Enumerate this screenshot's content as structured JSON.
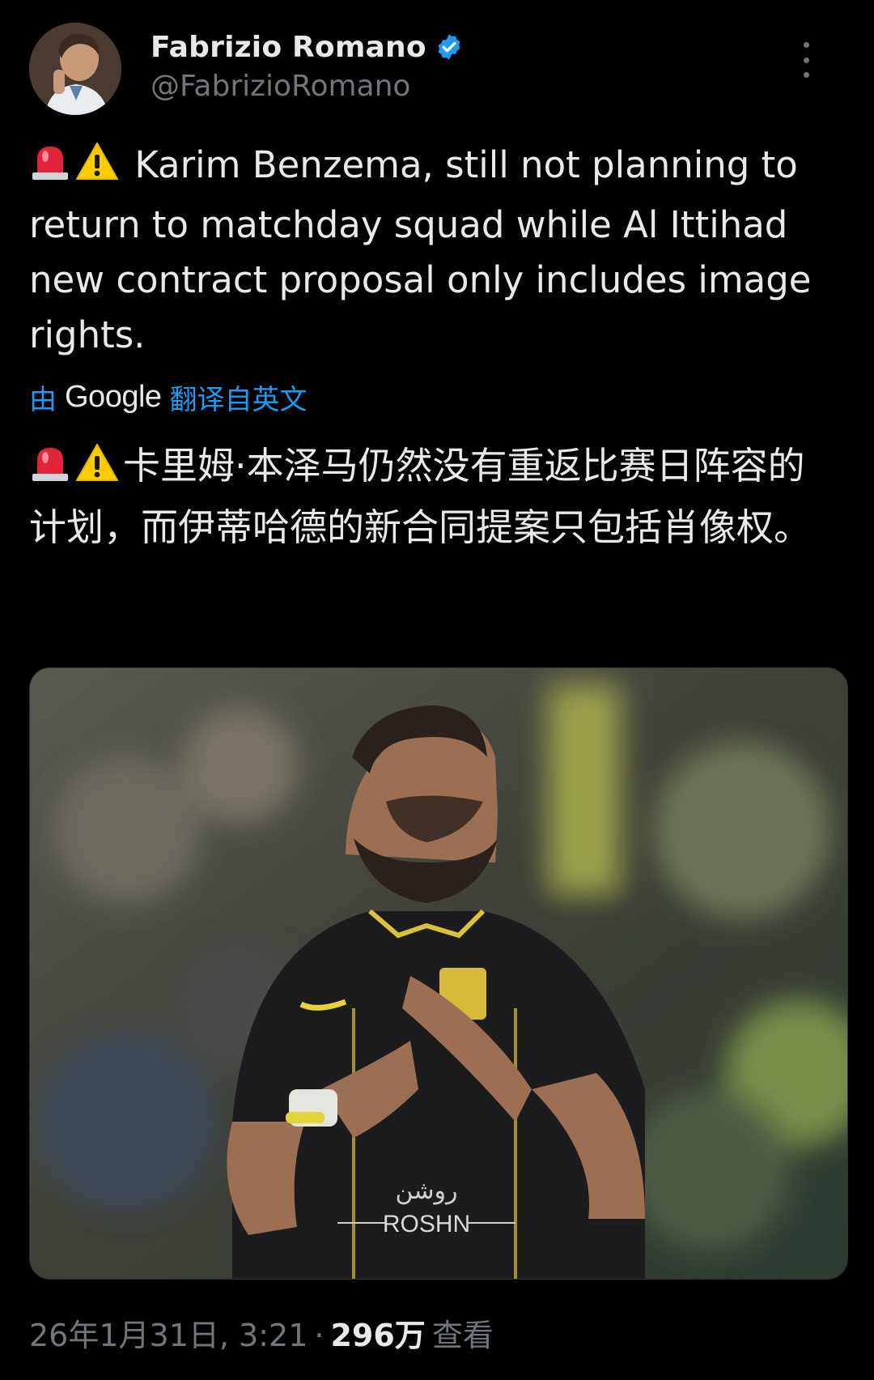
{
  "author": {
    "display_name": "Fabrizio Romano",
    "handle": "@FabrizioRomano",
    "verified": true,
    "verified_color": "#1d9bf0"
  },
  "tweet": {
    "emojis": [
      "rotating-light",
      "warning"
    ],
    "text": "Karim Benzema, still not planning to return to matchday squad while Al Ittihad new contract proposal only includes image rights.",
    "translation": {
      "prefix": "由",
      "provider": "Google",
      "link_label": "翻译自英文",
      "text": "卡里姆·本泽马仍然没有重返比赛日阵容的计划，而伊蒂哈德的新合同提案只包括肖像权。"
    },
    "media": {
      "jersey_text_latin": "ROSHN",
      "jersey_text_arabic": "روشن"
    }
  },
  "meta": {
    "timestamp": "26年1月31日, 3:21",
    "separator": "·",
    "views_count": "296万",
    "views_label": "查看"
  },
  "colors": {
    "background": "#000000",
    "text_primary": "#e7e9ea",
    "text_secondary": "#71767b",
    "link": "#1d9bf0"
  }
}
